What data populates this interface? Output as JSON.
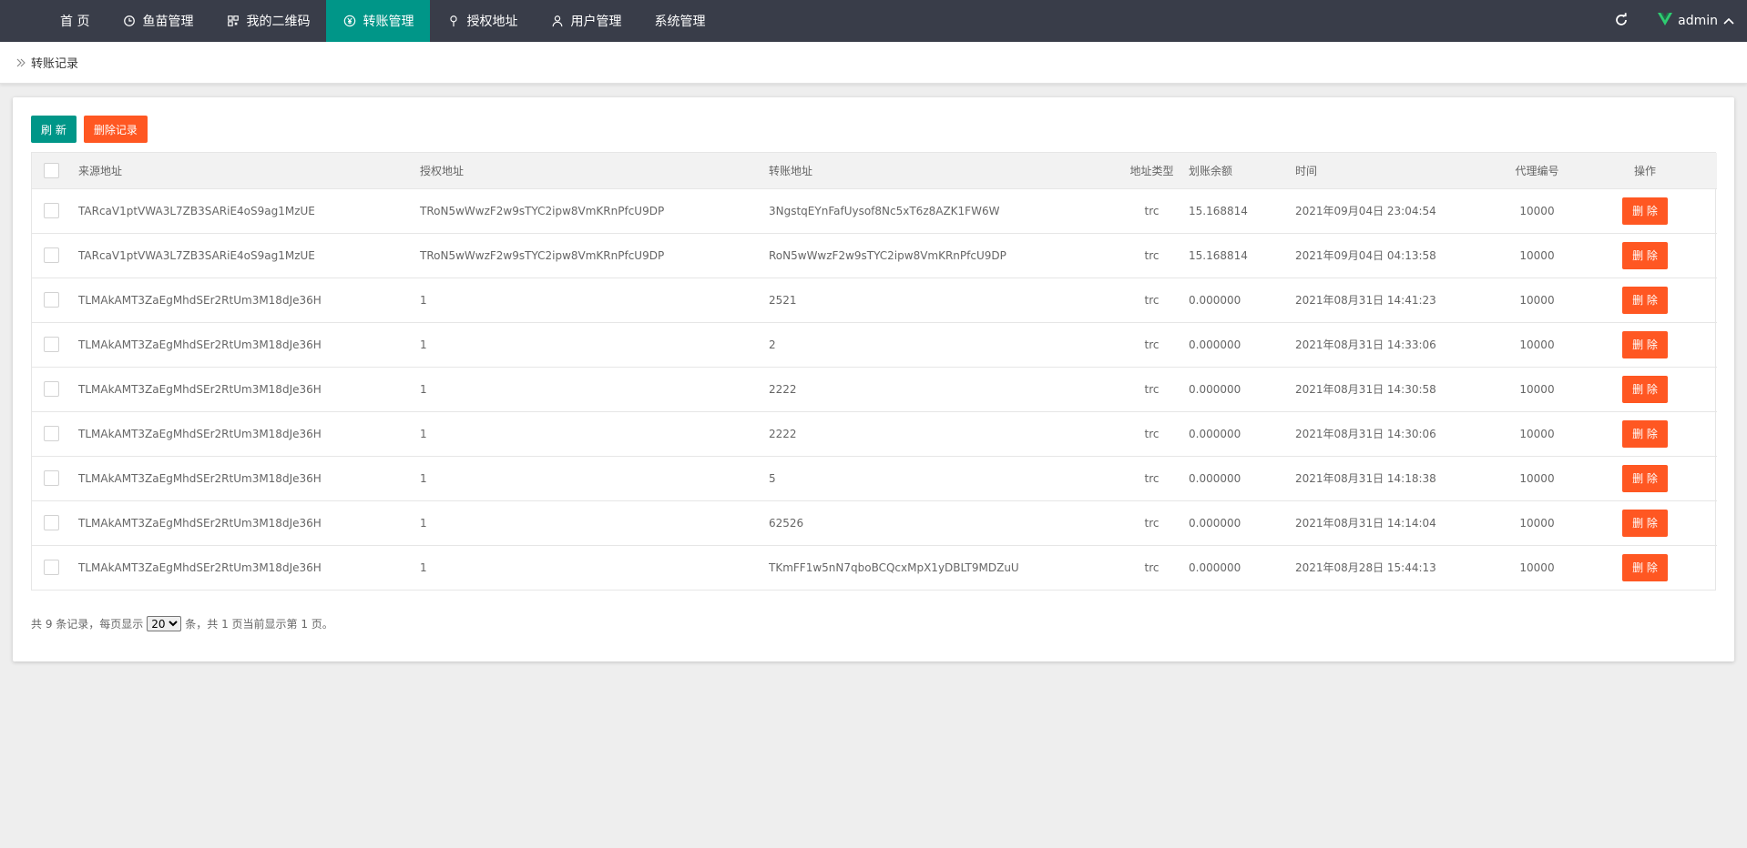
{
  "nav": {
    "items": [
      {
        "label": "首 页",
        "icon": "",
        "active": false
      },
      {
        "label": "鱼苗管理",
        "icon": "clock-icon",
        "active": false
      },
      {
        "label": "我的二维码",
        "icon": "qrcode-icon",
        "active": false
      },
      {
        "label": "转账管理",
        "icon": "yen-icon",
        "active": true
      },
      {
        "label": "授权地址",
        "icon": "location-pin-icon",
        "active": false
      },
      {
        "label": "用户管理",
        "icon": "user-icon",
        "active": false
      },
      {
        "label": "系统管理",
        "icon": "",
        "active": false
      }
    ],
    "user": "admin"
  },
  "breadcrumb": {
    "current": "转账记录"
  },
  "toolbar": {
    "refresh_label": "刷 新",
    "delete_records_label": "删除记录"
  },
  "table": {
    "headers": [
      "来源地址",
      "授权地址",
      "转账地址",
      "地址类型",
      "划账余额",
      "时间",
      "代理编号",
      "操作"
    ],
    "rows": [
      [
        "TARcaV1ptVWA3L7ZB3SARiE4oS9ag1MzUE",
        "TRoN5wWwzF2w9sTYC2ipw8VmKRnPfcU9DP",
        "3NgstqEYnFafUysof8Nc5xT6z8AZK1FW6W",
        "trc",
        "15.168814",
        "2021年09月04日 23:04:54",
        "10000"
      ],
      [
        "TARcaV1ptVWA3L7ZB3SARiE4oS9ag1MzUE",
        "TRoN5wWwzF2w9sTYC2ipw8VmKRnPfcU9DP",
        "RoN5wWwzF2w9sTYC2ipw8VmKRnPfcU9DP",
        "trc",
        "15.168814",
        "2021年09月04日 04:13:58",
        "10000"
      ],
      [
        "TLMAkAMT3ZaEgMhdSEr2RtUm3M18dJe36H",
        "1",
        "2521",
        "trc",
        "0.000000",
        "2021年08月31日 14:41:23",
        "10000"
      ],
      [
        "TLMAkAMT3ZaEgMhdSEr2RtUm3M18dJe36H",
        "1",
        "2",
        "trc",
        "0.000000",
        "2021年08月31日 14:33:06",
        "10000"
      ],
      [
        "TLMAkAMT3ZaEgMhdSEr2RtUm3M18dJe36H",
        "1",
        "2222",
        "trc",
        "0.000000",
        "2021年08月31日 14:30:58",
        "10000"
      ],
      [
        "TLMAkAMT3ZaEgMhdSEr2RtUm3M18dJe36H",
        "1",
        "2222",
        "trc",
        "0.000000",
        "2021年08月31日 14:30:06",
        "10000"
      ],
      [
        "TLMAkAMT3ZaEgMhdSEr2RtUm3M18dJe36H",
        "1",
        "5",
        "trc",
        "0.000000",
        "2021年08月31日 14:18:38",
        "10000"
      ],
      [
        "TLMAkAMT3ZaEgMhdSEr2RtUm3M18dJe36H",
        "1",
        "62526",
        "trc",
        "0.000000",
        "2021年08月31日 14:14:04",
        "10000"
      ],
      [
        "TLMAkAMT3ZaEgMhdSEr2RtUm3M18dJe36H",
        "1",
        "TKmFF1w5nN7qboBCQcxMpX1yDBLT9MDZuU",
        "trc",
        "0.000000",
        "2021年08月28日 15:44:13",
        "10000"
      ]
    ],
    "delete_label": "删 除"
  },
  "pager": {
    "prefix": "共 9 条记录，每页显示",
    "page_size": "20",
    "suffix": "条，共 1 页当前显示第 1 页。"
  },
  "colors": {
    "nav_bg": "#393d49",
    "active": "#009688",
    "danger": "#ff5722",
    "brand_v": "#2ecc71"
  }
}
